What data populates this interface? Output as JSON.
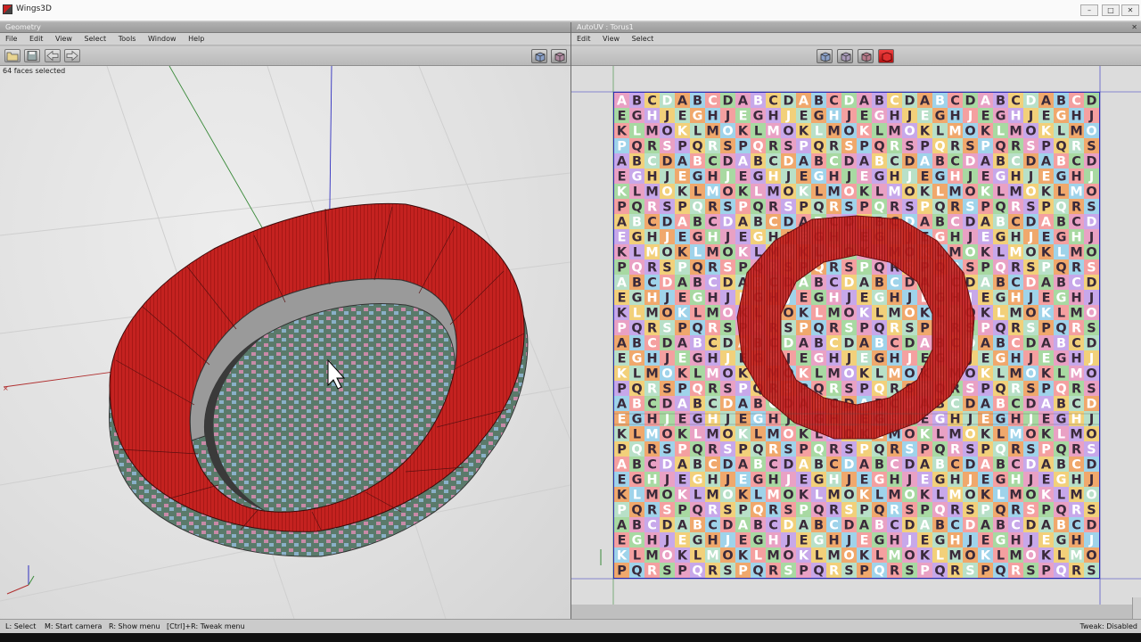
{
  "window": {
    "title": "Wings3D"
  },
  "geometry_panel": {
    "title": "Geometry",
    "menu": [
      "File",
      "Edit",
      "View",
      "Select",
      "Tools",
      "Window",
      "Help"
    ],
    "selection_info": "64 faces selected"
  },
  "autouv_panel": {
    "title": "AutoUV : Torus1",
    "menu": [
      "Edit",
      "View",
      "Select"
    ],
    "texture_letters": [
      [
        "A",
        "B",
        "C",
        "D"
      ],
      [
        "E",
        "G",
        "H",
        "J"
      ],
      [
        "K",
        "L",
        "M",
        "O"
      ],
      [
        "P",
        "Q",
        "R",
        "S"
      ]
    ],
    "texture_colors": [
      "#e9a1c4",
      "#9fd3ea",
      "#f2d07a",
      "#a8d9a2",
      "#f0a86c",
      "#c7a8ea",
      "#f4a0a0",
      "#b8e0c8"
    ]
  },
  "statusbar": {
    "hint_select": "L: Select",
    "hint_camera": "M: Start camera",
    "hint_menu": "R: Show menu",
    "hint_tweak": "[Ctrl]+R: Tweak menu",
    "tweak_status": "Tweak: Disabled"
  },
  "colors": {
    "selection_red": "#c8201e",
    "axis_x": "#b03030",
    "axis_y": "#3a8a3a",
    "axis_z": "#3030c0"
  },
  "icons": [
    "open-file-icon",
    "save-icon",
    "undo-icon",
    "redo-icon",
    "view-cube-icon",
    "close-icon"
  ]
}
